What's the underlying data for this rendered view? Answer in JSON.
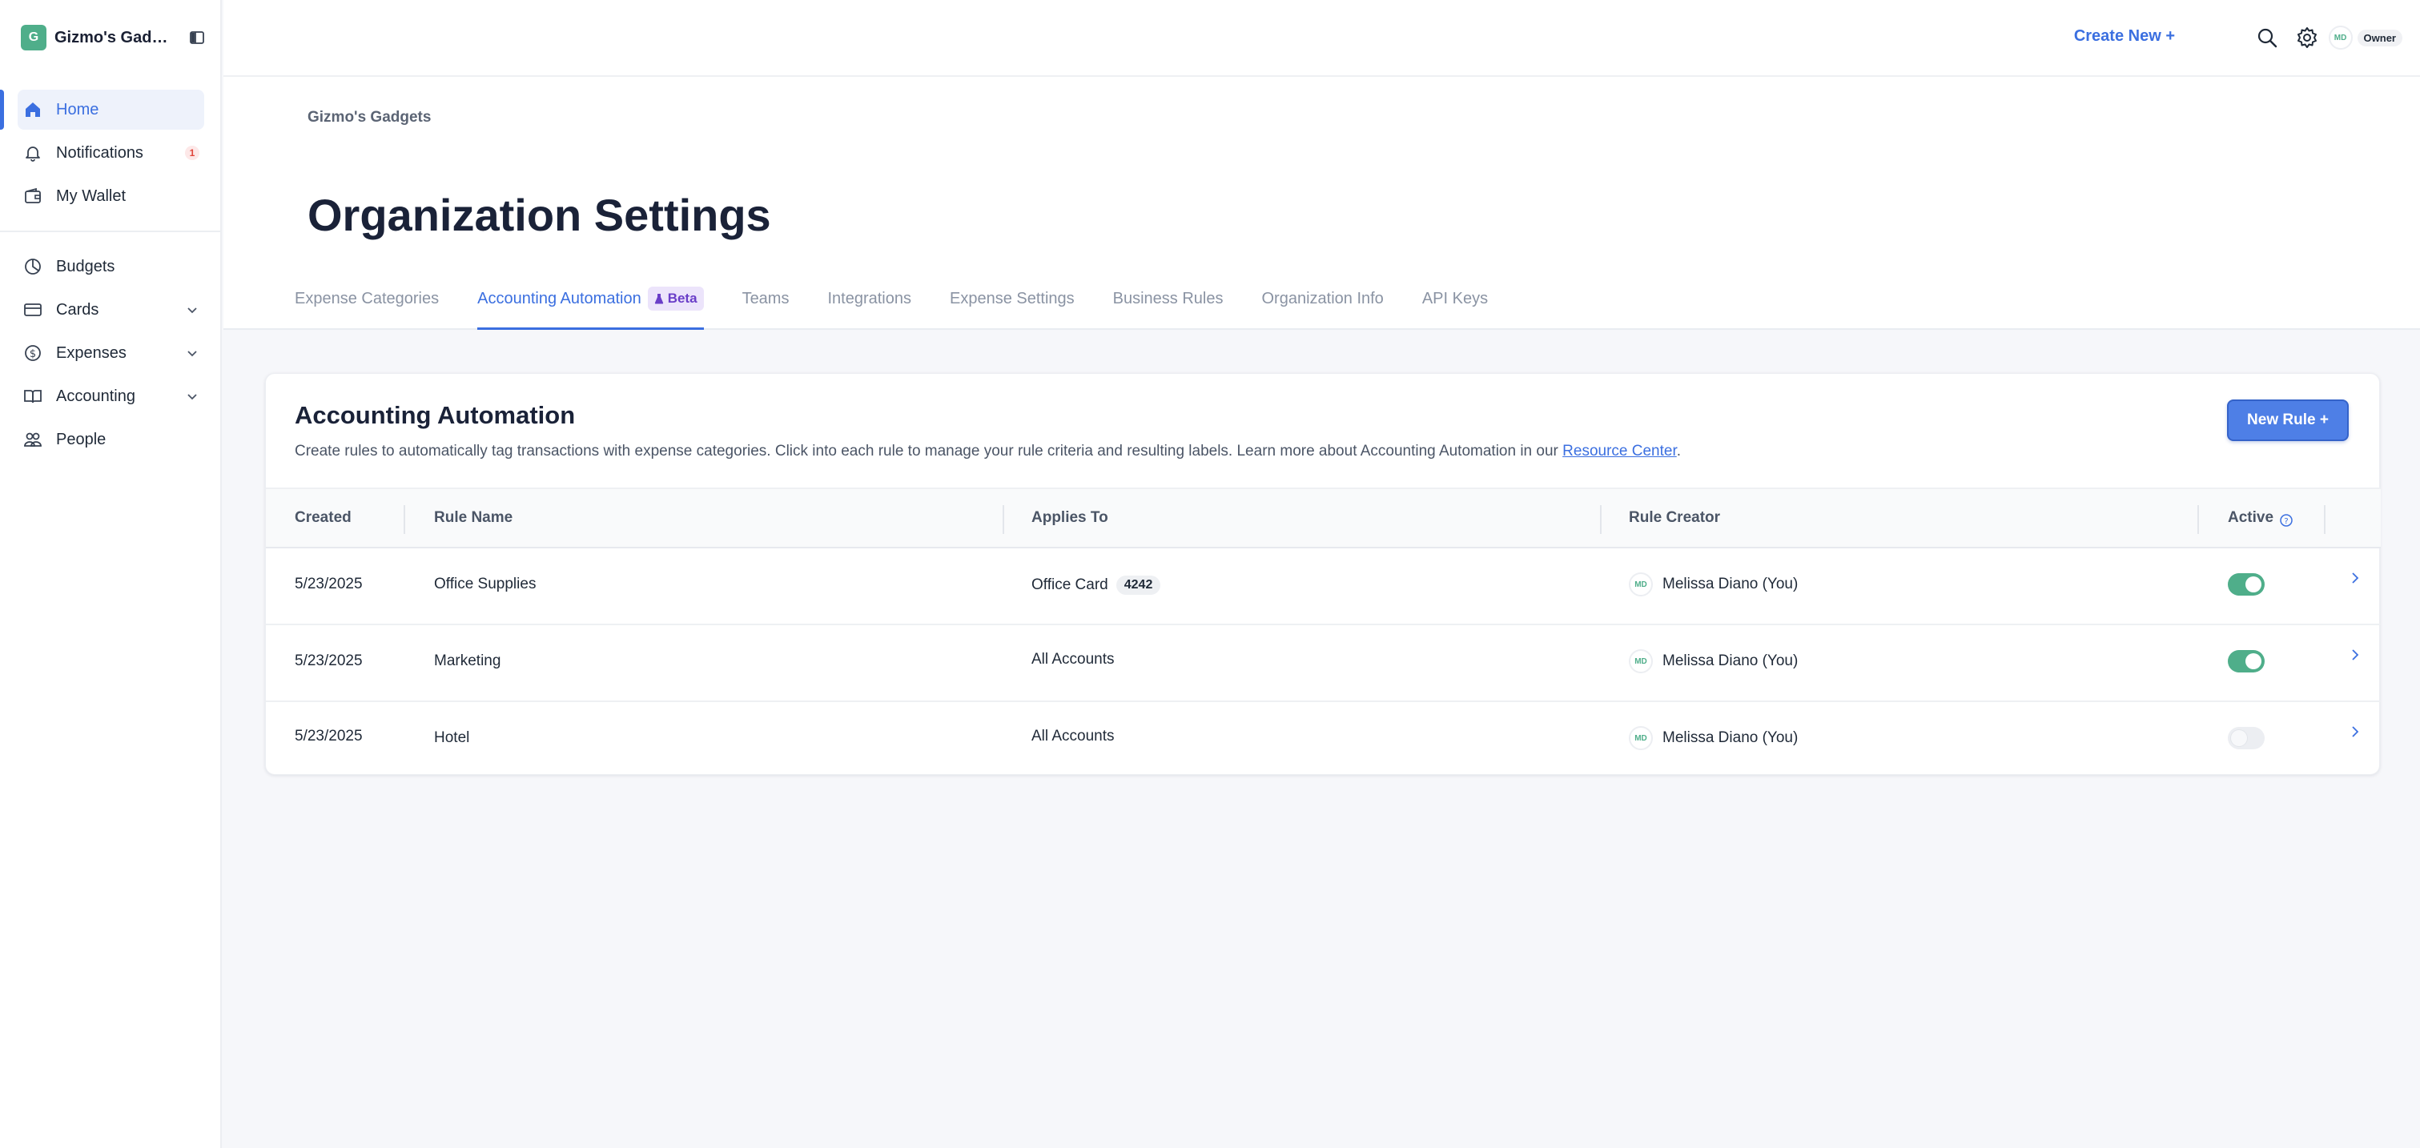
{
  "org": {
    "logo_letter": "G",
    "name": "Gizmo's Gadgets"
  },
  "sidebar": {
    "items": [
      {
        "label": "Home",
        "icon": "home-icon",
        "active": true
      },
      {
        "label": "Notifications",
        "icon": "bell-icon",
        "badge": "1"
      },
      {
        "label": "My Wallet",
        "icon": "wallet-icon"
      },
      {
        "label": "Budgets",
        "icon": "pie-chart-icon"
      },
      {
        "label": "Cards",
        "icon": "credit-card-icon",
        "expandable": true
      },
      {
        "label": "Expenses",
        "icon": "dollar-circle-icon",
        "expandable": true
      },
      {
        "label": "Accounting",
        "icon": "book-icon",
        "expandable": true
      },
      {
        "label": "People",
        "icon": "people-icon"
      }
    ]
  },
  "topbar": {
    "create_new": "Create New +",
    "user_initials": "MD",
    "user_role": "Owner"
  },
  "page": {
    "breadcrumb": "Gizmo's Gadgets",
    "title": "Organization Settings",
    "tabs": [
      {
        "label": "Expense Categories"
      },
      {
        "label": "Accounting Automation",
        "active": true,
        "badge": "Beta"
      },
      {
        "label": "Teams"
      },
      {
        "label": "Integrations"
      },
      {
        "label": "Expense Settings"
      },
      {
        "label": "Business Rules"
      },
      {
        "label": "Organization Info"
      },
      {
        "label": "API Keys"
      }
    ]
  },
  "card": {
    "title": "Accounting Automation",
    "description": "Create rules to automatically tag transactions with expense categories. Click into each rule to manage your rule criteria and resulting labels. Learn more about Accounting Automation in our ",
    "link_text": "Resource Center",
    "description_end": ".",
    "new_rule_button": "New Rule +"
  },
  "table": {
    "headers": {
      "created": "Created",
      "rule_name": "Rule Name",
      "applies_to": "Applies To",
      "rule_creator": "Rule Creator",
      "active": "Active"
    },
    "rows": [
      {
        "created": "5/23/2025",
        "rule_name": "Office Supplies",
        "applies_to": "Office Card",
        "card_number": "4242",
        "creator_initials": "MD",
        "creator": "Melissa Diano (You)",
        "active": true
      },
      {
        "created": "5/23/2025",
        "rule_name": "Marketing",
        "applies_to": "All Accounts",
        "creator_initials": "MD",
        "creator": "Melissa Diano (You)",
        "active": true
      },
      {
        "created": "5/23/2025",
        "rule_name": "Hotel",
        "applies_to": "All Accounts",
        "creator_initials": "MD",
        "creator": "Melissa Diano (You)",
        "active": false
      }
    ]
  },
  "colors": {
    "accent": "#3b6fe0",
    "brand_green": "#4fae8a",
    "beta_purple": "#6a3ec8",
    "notification_red": "#e0463c"
  }
}
